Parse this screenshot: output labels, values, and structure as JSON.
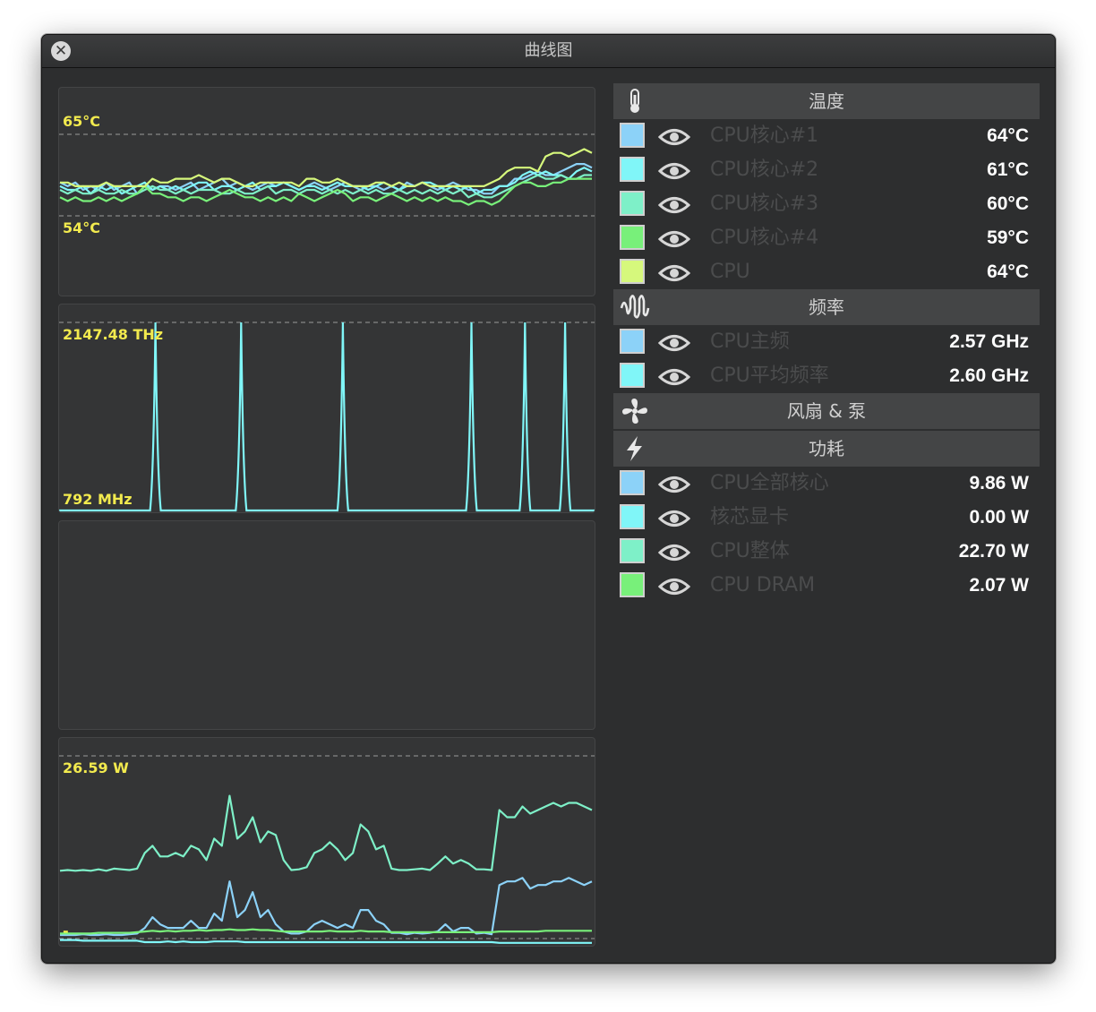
{
  "window": {
    "title": "曲线图"
  },
  "charts": {
    "temperature": {
      "max_label": "65°C",
      "min_label": "54°C"
    },
    "frequency": {
      "max_label": "2147.48 THz",
      "min_label": "792 MHz"
    },
    "power": {
      "max_label": "26.59 W",
      "min_label": "-"
    }
  },
  "colors": {
    "blue": "#8cd2f8",
    "cyan": "#80f6f8",
    "aqua": "#7ef0c8",
    "green": "#78f07a",
    "lime": "#d6f87c"
  },
  "sidebar": {
    "sections": [
      {
        "title": "温度",
        "icon": "thermometer-icon",
        "rows": [
          {
            "name": "CPU核心#1",
            "value": "64°C",
            "color": "#8cd2f8"
          },
          {
            "name": "CPU核心#2",
            "value": "61°C",
            "color": "#80f6f8"
          },
          {
            "name": "CPU核心#3",
            "value": "60°C",
            "color": "#7ef0c8"
          },
          {
            "name": "CPU核心#4",
            "value": "59°C",
            "color": "#78f07a"
          },
          {
            "name": "CPU",
            "value": "64°C",
            "color": "#d6f87c"
          }
        ]
      },
      {
        "title": "频率",
        "icon": "frequency-wave-icon",
        "rows": [
          {
            "name": "CPU主频",
            "value": "2.57 GHz",
            "color": "#8cd2f8"
          },
          {
            "name": "CPU平均频率",
            "value": "2.60 GHz",
            "color": "#80f6f8"
          }
        ]
      },
      {
        "title": "风扇 & 泵",
        "icon": "fan-icon",
        "rows": []
      },
      {
        "title": "功耗",
        "icon": "lightning-icon",
        "rows": [
          {
            "name": "CPU全部核心",
            "value": "9.86 W",
            "color": "#8cd2f8"
          },
          {
            "name": "核芯显卡",
            "value": "0.00 W",
            "color": "#80f6f8"
          },
          {
            "name": "CPU整体",
            "value": "22.70 W",
            "color": "#7ef0c8"
          },
          {
            "name": "CPU DRAM",
            "value": "2.07 W",
            "color": "#78f07a"
          }
        ]
      }
    ]
  },
  "chart_data": [
    {
      "type": "line",
      "title": "",
      "ylim": [
        54,
        65
      ],
      "grid": false,
      "series": [
        {
          "name": "CPU核心#1",
          "color": "#8cd2f8",
          "values": [
            58.5,
            58,
            58.5,
            57.5,
            58,
            57.5,
            58.5,
            57.5,
            58,
            58.5,
            57,
            58,
            57.5,
            58,
            58,
            57.5,
            58,
            58.5,
            57.5,
            58,
            58.5,
            59,
            58,
            58.5,
            58,
            57.5,
            58,
            58.5,
            58,
            58.5,
            58,
            57.5,
            58,
            58.5,
            58,
            57.5,
            58,
            58.5,
            58,
            57.5,
            58,
            58,
            57.5,
            58,
            57.5,
            58.5,
            58,
            58.5,
            58,
            57.5,
            58,
            58.5,
            58,
            57.5,
            57.5,
            57,
            57,
            58,
            58,
            59,
            59,
            59.5,
            60,
            59.5,
            59.5,
            60,
            60.5,
            61,
            61,
            60.5
          ]
        },
        {
          "name": "CPU核心#2",
          "color": "#80f6f8",
          "values": [
            58,
            57.5,
            57.5,
            58,
            57,
            58,
            57.5,
            58,
            57,
            57.5,
            58,
            58.5,
            57.5,
            58,
            57.5,
            58,
            57.5,
            58,
            58.5,
            58.5,
            57.5,
            58,
            58,
            57.5,
            58,
            58.5,
            57.5,
            58,
            58,
            58.5,
            58,
            57.5,
            58,
            58,
            57.5,
            58,
            58.5,
            58,
            58,
            58,
            57.5,
            58,
            58.5,
            58,
            57.5,
            58,
            58,
            58.5,
            58.5,
            58,
            57.5,
            58,
            57.5,
            58,
            57,
            57.5,
            57.5,
            58,
            58,
            58.5,
            59.5,
            60,
            59.5,
            60,
            59.5,
            59.5,
            59,
            60,
            60.5,
            60
          ]
        },
        {
          "name": "CPU核心#3",
          "color": "#7ef0c8",
          "values": [
            57.5,
            57,
            57.5,
            57,
            57,
            57.5,
            57,
            57,
            57.5,
            57,
            57,
            57.5,
            58,
            57.5,
            57.5,
            57,
            57.5,
            57,
            57.5,
            57.5,
            57.5,
            57,
            57,
            57.5,
            57,
            57,
            57.5,
            58,
            57,
            57.5,
            57.5,
            57,
            57.5,
            57.5,
            57,
            57.5,
            57,
            57.5,
            57,
            57.5,
            57,
            57.5,
            57,
            57,
            57.5,
            57,
            57.5,
            57,
            57.5,
            57,
            57.5,
            57,
            57.5,
            56.5,
            57,
            56.5,
            56.5,
            57,
            57.5,
            58,
            58.5,
            59,
            59.5,
            59,
            59,
            59.5,
            59,
            59,
            59.5,
            59.5
          ]
        },
        {
          "name": "CPU核心#4",
          "color": "#78f07a",
          "values": [
            56.5,
            56,
            56.5,
            56,
            56,
            56.5,
            56,
            56.5,
            56,
            56.5,
            57,
            58,
            57,
            57,
            56.5,
            56.5,
            56,
            56.5,
            56.5,
            56,
            56.5,
            57,
            57.5,
            57,
            56.5,
            56.5,
            56,
            56.5,
            56,
            56.5,
            56,
            57,
            56.5,
            56,
            56.5,
            57,
            57.5,
            57,
            56,
            56.5,
            56.5,
            56,
            56.5,
            57,
            56.5,
            56,
            56.5,
            56,
            56.5,
            56,
            56.5,
            56,
            56,
            55.5,
            56,
            56,
            55.5,
            56,
            57,
            58,
            58.5,
            58.5,
            58,
            58,
            58.5,
            58.5,
            59,
            59,
            59,
            59
          ]
        },
        {
          "name": "CPU",
          "color": "#d6f87c",
          "values": [
            58.5,
            58.5,
            58,
            58,
            58,
            58,
            58.5,
            58,
            58,
            58,
            58,
            58,
            59,
            58.5,
            58.5,
            59,
            59,
            59,
            59.5,
            59,
            58.5,
            59,
            59,
            58.5,
            58,
            58,
            58.5,
            58.5,
            58.5,
            58.5,
            58.5,
            58,
            59,
            59,
            58.5,
            58.5,
            59,
            58.5,
            58,
            58,
            58,
            58.5,
            58.5,
            58,
            58.5,
            58,
            58,
            58.5,
            58,
            58,
            58,
            58,
            58,
            58,
            58,
            58,
            58.5,
            59,
            60,
            60.5,
            60.5,
            60.5,
            60,
            62,
            62.5,
            62.5,
            62,
            62.5,
            63,
            62.5
          ]
        }
      ]
    },
    {
      "type": "line",
      "title": "",
      "ylim": [
        "792 MHz",
        "2147.48 THz"
      ],
      "grid": false,
      "series": [
        {
          "name": "CPU主频",
          "color": "#8cd2f8",
          "values": [
            "2.57 GHz"
          ]
        },
        {
          "name": "CPU平均频率",
          "color": "#80f6f8",
          "spike_x_fraction": [
            0.18,
            0.34,
            0.53,
            0.77,
            0.87,
            0.945
          ]
        }
      ]
    },
    {
      "type": "line",
      "title": "",
      "ylim": [
        0,
        26.59
      ],
      "grid": false,
      "series": [
        {
          "name": "CPU整体",
          "color": "#7ef0c8",
          "values": [
            10.5,
            10.6,
            10.5,
            10.6,
            10.5,
            10.7,
            10.5,
            10.8,
            10.7,
            10.6,
            10.8,
            13,
            14,
            12.5,
            12.5,
            13,
            12.5,
            14,
            13.5,
            12,
            15,
            14,
            21,
            15,
            16,
            18,
            14.5,
            16,
            15.5,
            12,
            10.6,
            10.7,
            11,
            13,
            13.5,
            14.5,
            13.5,
            12,
            13,
            17,
            16,
            13.5,
            14,
            10.8,
            10.6,
            10.6,
            10.7,
            10.8,
            10.6,
            11.5,
            12.5,
            11.5,
            12,
            11.5,
            10.7,
            10.7,
            10.6,
            19,
            18,
            18,
            19.5,
            18.5,
            19,
            19.5,
            20,
            19.5,
            20,
            20,
            19.5,
            19
          ]
        },
        {
          "name": "CPU全部核心",
          "color": "#8cd2f8",
          "values": [
            1.5,
            1.5,
            1.5,
            1.6,
            1.5,
            1.5,
            1.6,
            1.5,
            1.5,
            1.6,
            1.7,
            2.5,
            4,
            3,
            2.5,
            2.5,
            2.5,
            3.5,
            2.5,
            2.5,
            4.5,
            3.5,
            9,
            4,
            5,
            7.5,
            4,
            5,
            3,
            2,
            1.7,
            1.7,
            2,
            3,
            3.5,
            3,
            2.5,
            3,
            2.5,
            5,
            5,
            3.5,
            3,
            1.8,
            1.8,
            1.6,
            1.8,
            1.7,
            1.8,
            2,
            3,
            2,
            2.5,
            2.5,
            1.7,
            1.8,
            1.6,
            8.5,
            9,
            9,
            9.5,
            8,
            8.5,
            8.5,
            9,
            9,
            9.5,
            9,
            8.5,
            9
          ]
        },
        {
          "name": "CPU DRAM",
          "color": "#78f07a",
          "values": [
            1.7,
            1.7,
            1.7,
            1.7,
            1.7,
            1.8,
            1.8,
            1.8,
            1.8,
            1.8,
            1.9,
            2,
            2.1,
            2,
            2.1,
            2,
            2.1,
            2.1,
            2.2,
            2.1,
            2.2,
            2.2,
            2.3,
            2.2,
            2.2,
            2.3,
            2.2,
            2.2,
            2.1,
            2,
            2,
            2,
            2,
            2,
            2,
            2.1,
            2,
            2,
            2,
            2.1,
            2,
            2,
            2,
            1.9,
            1.9,
            1.9,
            1.9,
            1.9,
            1.9,
            1.9,
            1.9,
            1.9,
            1.9,
            1.9,
            1.9,
            1.9,
            1.9,
            2,
            2,
            2,
            2,
            2,
            2,
            2.1,
            2.1,
            2.1,
            2.1,
            2.1,
            2.1,
            2.1
          ]
        },
        {
          "name": "核芯显卡",
          "color": "#80f6f8",
          "values": [
            0.8,
            0.8,
            0.8,
            0.7,
            0.7,
            0.7,
            0.7,
            0.7,
            0.7,
            0.7,
            0.7,
            0.5,
            0.5,
            0.5,
            0.6,
            0.5,
            0.6,
            0.5,
            0.5,
            0.5,
            0.6,
            0.6,
            0.6,
            0.6,
            0.5,
            0.5,
            0.5,
            0.5,
            0.5,
            0.5,
            0.5,
            0.5,
            0.5,
            0.5,
            0.5,
            0.5,
            0.5,
            0.5,
            0.5,
            0.5,
            0.5,
            0.5,
            0.5,
            0.5,
            0.5,
            0.5,
            0.5,
            0.5,
            0.5,
            0.5,
            0.5,
            0.5,
            0.5,
            0.5,
            0.5,
            0.5,
            0.5,
            0.4,
            0.4,
            0.4,
            0.4,
            0.4,
            0.4,
            0.4,
            0.4,
            0.4,
            0.4,
            0.4,
            0.4,
            0.4
          ]
        }
      ]
    }
  ]
}
